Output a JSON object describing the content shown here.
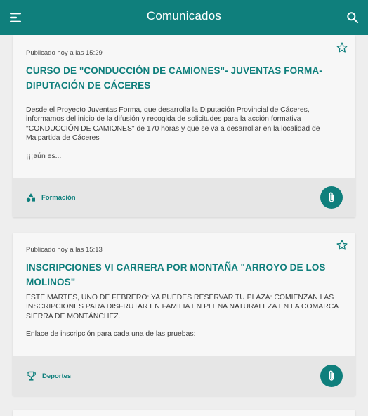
{
  "header": {
    "title": "Comunicados",
    "menu_icon": "menu-icon",
    "search_icon": "search-icon"
  },
  "colors": {
    "primary": "#0f7f7c",
    "background": "#eeeeee",
    "card": "#f7f7f7",
    "card_footer": "#e6e6e6"
  },
  "posts": [
    {
      "date": "Publicado hoy a las 15:29",
      "title": "CURSO DE \"CONDUCCIÓN DE CAMIONES\"- JUVENTAS FORMA-DIPUTACIÓN DE CÁCERES",
      "text": "Desde el Proyecto Juventas Forma, que desarrolla la Diputación Provincial de Cáceres, informamos del inicio de la difusión y recogida de solicitudes para la acción formativa \"CONDUCCIÓN DE CAMIONES\" de 170 horas y que se va a desarrollar en la localidad de Malpartida de Cáceres",
      "more": "¡¡¡aún es...",
      "category": "Formación",
      "category_icon": "shapes-icon"
    },
    {
      "date": "Publicado hoy a las 15:13",
      "title": "INSCRIPCIONES VI CARRERA POR MONTAÑA  \"ARROYO DE LOS MOLINOS\"",
      "text": "ESTE MARTES, UNO DE FEBRERO: YA PUEDES RESERVAR TU PLAZA: COMIENZAN LAS INSCRIPCIONES PARA DISFRUTAR EN FAMILIA EN PLENA NATURALEZA EN LA COMARCA SIERRA DE MONTÁNCHEZ.",
      "more": "Enlace de inscripción para cada una de las pruebas:",
      "category": "Deportes",
      "category_icon": "trophy-icon"
    }
  ]
}
